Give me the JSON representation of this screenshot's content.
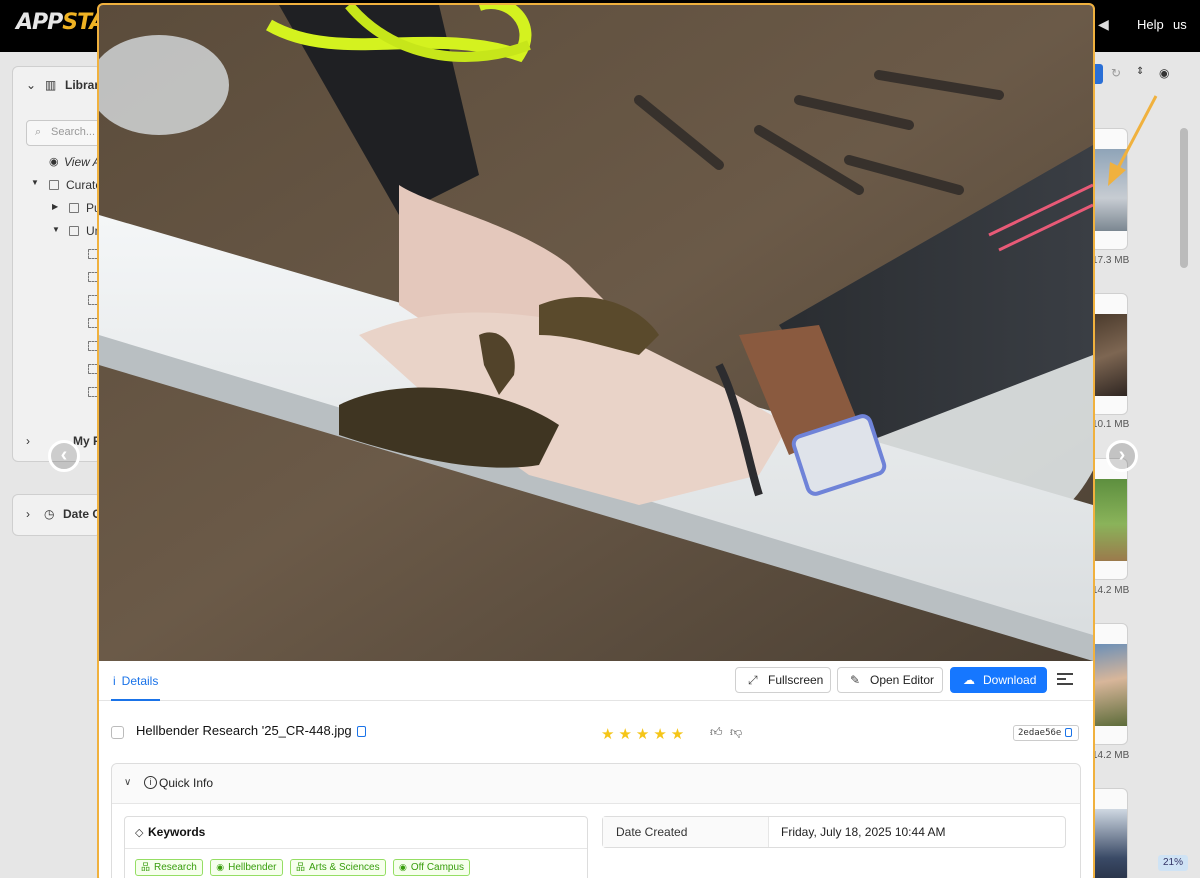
{
  "app": {
    "logo_part1": "APP",
    "logo_part2": "STAT",
    "help_label": "Help",
    "lang_label": "us",
    "zoom_level": "21%"
  },
  "sidebar": {
    "libraries_label": "Librari",
    "search_placeholder": "Search...",
    "view_all_label": "View A",
    "curated_label": "Curate",
    "folder_pub_label": "Pu",
    "folder_un_label": "Un",
    "my_label": "My F",
    "date_label": "Date C"
  },
  "grid": {
    "sizes": [
      "17.3 MB",
      "10.1 MB",
      "14.2 MB",
      "14.2 MB"
    ]
  },
  "viewer": {
    "tab_details": "Details",
    "fullscreen_label": "Fullscreen",
    "open_editor_label": "Open Editor",
    "download_label": "Download",
    "filename": "Hellbender Research '25_CR-448.jpg",
    "rating": 5,
    "stars": "★★★★★",
    "hash": "2edae56e",
    "accent_color": "#1677ff",
    "modal_border_color": "#f0b13e"
  },
  "quick_info": {
    "title": "Quick Info",
    "keywords_label": "Keywords",
    "keywords": [
      {
        "label": "Research",
        "icon": "hierarchy-icon"
      },
      {
        "label": "Hellbender",
        "icon": "eye-icon"
      },
      {
        "label": "Arts & Sciences",
        "icon": "hierarchy-icon"
      },
      {
        "label": "Off Campus",
        "icon": "eye-icon"
      }
    ],
    "date_created_label": "Date Created",
    "date_created_value": "Friday, July 18, 2025 10:44 AM"
  }
}
